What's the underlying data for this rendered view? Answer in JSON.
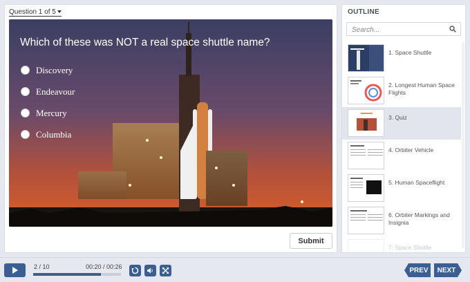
{
  "header": {
    "question_selector": "Question 1 of 5"
  },
  "quiz": {
    "question": "Which of these was NOT a real space shuttle name?",
    "options": [
      "Discovery",
      "Endeavour",
      "Mercury",
      "Columbia"
    ],
    "submit_label": "Submit"
  },
  "outline": {
    "title": "OUTLINE",
    "search_placeholder": "Search...",
    "items": [
      {
        "label": "1. Space Shuttle"
      },
      {
        "label": "2. Longest Human Space Flights"
      },
      {
        "label": "3. Quiz",
        "active": true
      },
      {
        "label": "4. Orbiter Vehicle"
      },
      {
        "label": "5. Human Spaceflight"
      },
      {
        "label": "6. Orbiter Markings and Insignia"
      },
      {
        "label": "7. Space Shuttle"
      }
    ]
  },
  "player": {
    "slide_counter": "2 / 10",
    "time": "00:20 / 00:26",
    "progress": 0.77,
    "prev_label": "PREV",
    "next_label": "NEXT"
  },
  "colors": {
    "accent": "#3b5f93"
  },
  "icons": [
    "chevron-down-icon",
    "search-icon",
    "play-icon",
    "replay-icon",
    "volume-icon",
    "fullscreen-icon"
  ]
}
